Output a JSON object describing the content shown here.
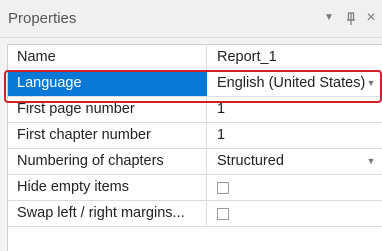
{
  "panel": {
    "title": "Properties",
    "icons": [
      "dropdown-arrow-icon",
      "pin-icon",
      "close-icon"
    ]
  },
  "properties": [
    {
      "name": "Name",
      "value": "Report_1",
      "type": "text"
    },
    {
      "name": "Language",
      "value": "English (United States)",
      "type": "dropdown",
      "selected": true
    },
    {
      "name": "First page number",
      "value": "1",
      "type": "text"
    },
    {
      "name": "First chapter number",
      "value": "1",
      "type": "text"
    },
    {
      "name": "Numbering of chapters",
      "value": "Structured",
      "type": "dropdown"
    },
    {
      "name": "Hide empty items",
      "value": false,
      "type": "checkbox"
    },
    {
      "name": "Swap left / right margins...",
      "value": false,
      "type": "checkbox"
    }
  ],
  "colors": {
    "selection": "#0a78d7",
    "highlight_border": "#d32027"
  }
}
